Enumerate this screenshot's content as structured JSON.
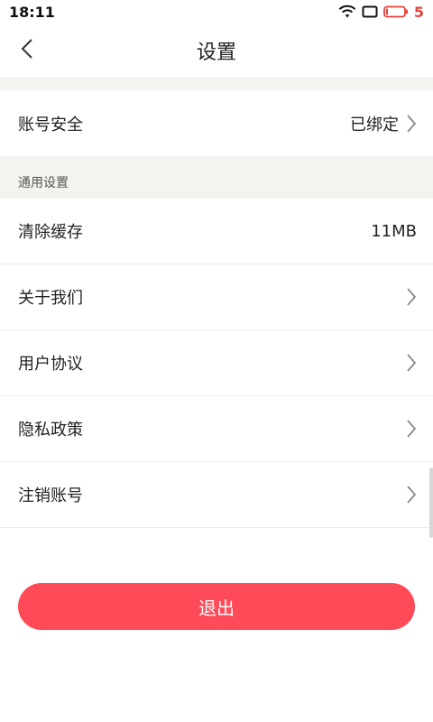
{
  "status_bar": {
    "time": "18:11",
    "battery_level": "5",
    "icons": [
      "wifi-icon",
      "screen-icon",
      "battery-icon"
    ]
  },
  "header": {
    "title": "设置",
    "back_icon": "chevron-left-icon"
  },
  "account": {
    "label": "账号安全",
    "value": "已绑定"
  },
  "general": {
    "section_title": "通用设置",
    "items": [
      {
        "label": "清除缓存",
        "value": "11MB"
      },
      {
        "label": "关于我们",
        "value": ""
      },
      {
        "label": "用户协议",
        "value": ""
      },
      {
        "label": "隐私政策",
        "value": ""
      },
      {
        "label": "注销账号",
        "value": ""
      }
    ]
  },
  "logout": {
    "label": "退出"
  },
  "colors": {
    "accent": "#ff4a57",
    "section_bg": "#f5f3ee",
    "battery": "#e8433a"
  }
}
